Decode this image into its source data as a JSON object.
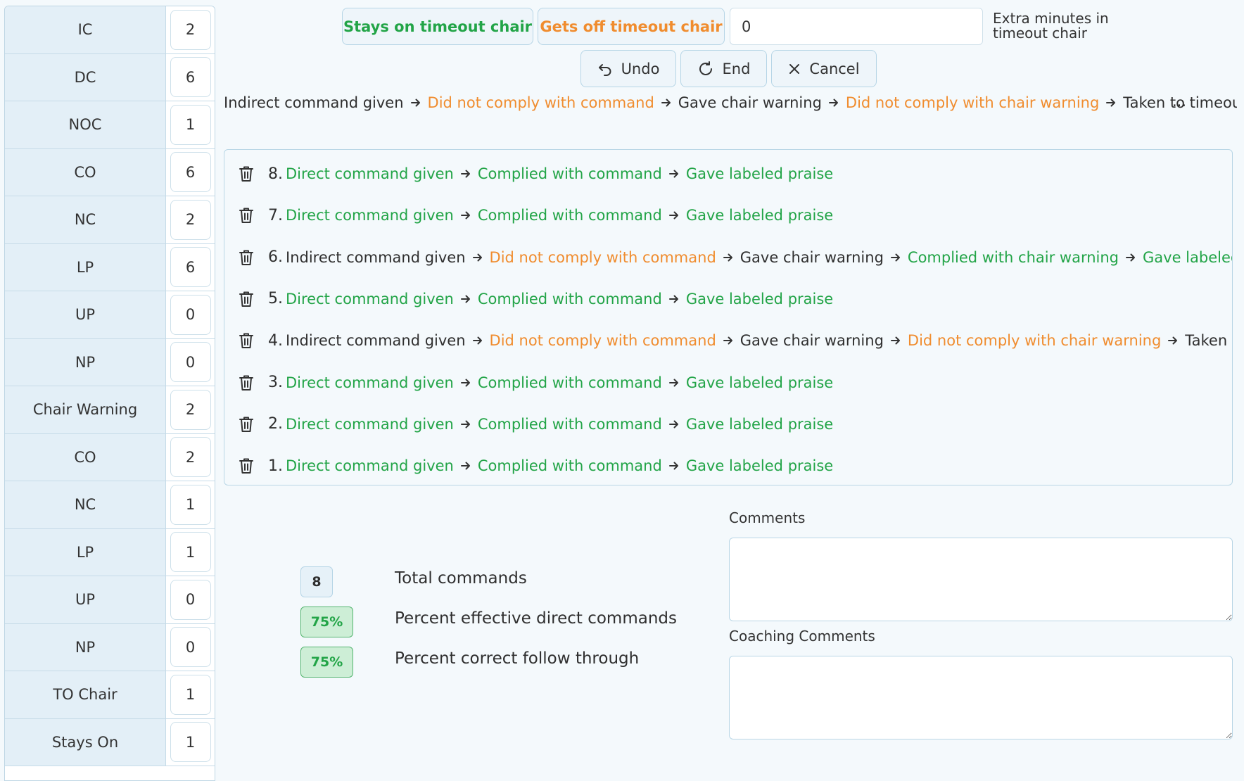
{
  "tally": [
    {
      "label": "IC",
      "count": "2"
    },
    {
      "label": "DC",
      "count": "6"
    },
    {
      "label": "NOC",
      "count": "1"
    },
    {
      "label": "CO",
      "count": "6"
    },
    {
      "label": "NC",
      "count": "2"
    },
    {
      "label": "LP",
      "count": "6"
    },
    {
      "label": "UP",
      "count": "0"
    },
    {
      "label": "NP",
      "count": "0"
    },
    {
      "label": "Chair Warning",
      "count": "2"
    },
    {
      "label": "CO",
      "count": "2"
    },
    {
      "label": "NC",
      "count": "1"
    },
    {
      "label": "LP",
      "count": "1"
    },
    {
      "label": "UP",
      "count": "0"
    },
    {
      "label": "NP",
      "count": "0"
    },
    {
      "label": "TO Chair",
      "count": "1"
    },
    {
      "label": "Stays On",
      "count": "1"
    }
  ],
  "controls": {
    "stays_on_label": "Stays on timeout chair",
    "gets_off_label": "Gets off timeout chair",
    "extra_minutes_value": "0",
    "extra_minutes_label": "Extra minutes in timeout chair",
    "undo_label": "Undo",
    "end_label": "End",
    "cancel_label": "Cancel",
    "accent_green": "#22a447",
    "accent_orange": "#f08c2e"
  },
  "current_sequence": {
    "steps": [
      {
        "text": "Indirect command given",
        "color": "black"
      },
      {
        "text": "Did not comply with command",
        "color": "orange"
      },
      {
        "text": "Gave chair warning",
        "color": "black"
      },
      {
        "text": "Did not comply with chair warning",
        "color": "orange"
      },
      {
        "text": "Taken to timeout chair",
        "color": "black"
      }
    ],
    "ellipsis": "..."
  },
  "history": [
    {
      "number": "8.",
      "steps": [
        {
          "text": "Direct command given",
          "color": "green"
        },
        {
          "text": "Complied with command",
          "color": "green"
        },
        {
          "text": "Gave labeled praise",
          "color": "green"
        }
      ]
    },
    {
      "number": "7.",
      "steps": [
        {
          "text": "Direct command given",
          "color": "green"
        },
        {
          "text": "Complied with command",
          "color": "green"
        },
        {
          "text": "Gave labeled praise",
          "color": "green"
        }
      ]
    },
    {
      "number": "6.",
      "steps": [
        {
          "text": "Indirect command given",
          "color": "black"
        },
        {
          "text": "Did not comply with command",
          "color": "orange"
        },
        {
          "text": "Gave chair warning",
          "color": "black"
        },
        {
          "text": "Complied with chair warning",
          "color": "green"
        },
        {
          "text": "Gave labeled praise for chair",
          "color": "green"
        }
      ]
    },
    {
      "number": "5.",
      "steps": [
        {
          "text": "Direct command given",
          "color": "green"
        },
        {
          "text": "Complied with command",
          "color": "green"
        },
        {
          "text": "Gave labeled praise",
          "color": "green"
        }
      ]
    },
    {
      "number": "4.",
      "steps": [
        {
          "text": "Indirect command given",
          "color": "black"
        },
        {
          "text": "Did not comply with command",
          "color": "orange"
        },
        {
          "text": "Gave chair warning",
          "color": "black"
        },
        {
          "text": "Did not comply with chair warning",
          "color": "orange"
        },
        {
          "text": "Taken to timeout chair",
          "color": "black"
        }
      ]
    },
    {
      "number": "3.",
      "steps": [
        {
          "text": "Direct command given",
          "color": "green"
        },
        {
          "text": "Complied with command",
          "color": "green"
        },
        {
          "text": "Gave labeled praise",
          "color": "green"
        }
      ]
    },
    {
      "number": "2.",
      "steps": [
        {
          "text": "Direct command given",
          "color": "green"
        },
        {
          "text": "Complied with command",
          "color": "green"
        },
        {
          "text": "Gave labeled praise",
          "color": "green"
        }
      ]
    },
    {
      "number": "1.",
      "steps": [
        {
          "text": "Direct command given",
          "color": "green"
        },
        {
          "text": "Complied with command",
          "color": "green"
        },
        {
          "text": "Gave labeled praise",
          "color": "green"
        }
      ]
    }
  ],
  "summary": {
    "total_commands": "8",
    "total_commands_label": "Total commands",
    "effective_direct": "75%",
    "effective_direct_label": "Percent effective direct commands",
    "follow_through": "75%",
    "follow_through_label": "Percent correct follow through"
  },
  "comments": {
    "comments_label": "Comments",
    "comments_value": "",
    "coaching_label": "Coaching Comments",
    "coaching_value": ""
  },
  "icons": {
    "undo": "undo-icon",
    "end": "refresh-icon",
    "cancel": "close-icon",
    "delete": "trash-icon",
    "step_separator": "arrow-right-icon"
  }
}
